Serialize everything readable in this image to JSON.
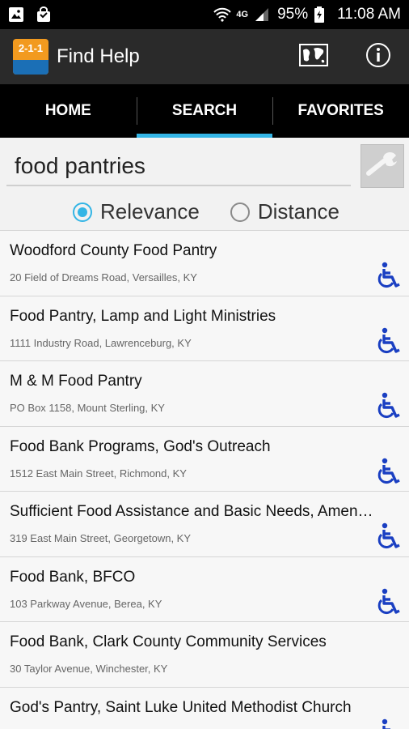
{
  "status_bar": {
    "signal_text": "4G",
    "battery": "95%",
    "time": "11:08 AM"
  },
  "app_bar": {
    "logo_text": "2-1-1",
    "title": "Find Help",
    "map_icon": "map-icon",
    "info_icon": "info-icon"
  },
  "tabs": [
    {
      "label": "HOME",
      "active": false
    },
    {
      "label": "SEARCH",
      "active": true
    },
    {
      "label": "FAVORITES",
      "active": false
    }
  ],
  "search": {
    "query": "food pantries",
    "settings_icon": "wrench-icon"
  },
  "sort": {
    "options": [
      {
        "label": "Relevance",
        "checked": true
      },
      {
        "label": "Distance",
        "checked": false
      }
    ]
  },
  "colors": {
    "accent": "#33b5e5",
    "access_icon": "#1a3fc2",
    "logo_orange": "#f29a1f",
    "logo_blue": "#1b6fb6"
  },
  "results": [
    {
      "name": "Woodford County Food Pantry",
      "address": "20 Field of Dreams Road, Versailles, KY"
    },
    {
      "name": "Food Pantry, Lamp and Light Ministries",
      "address": "1111 Industry Road, Lawrenceburg, KY"
    },
    {
      "name": "M & M Food Pantry",
      "address": "PO Box 1158, Mount Sterling, KY"
    },
    {
      "name": "Food Bank Programs, God's Outreach",
      "address": "1512 East Main Street, Richmond, KY"
    },
    {
      "name": "Sufficient Food Assistance and Basic Needs, Amen…",
      "address": "319 East Main Street, Georgetown, KY"
    },
    {
      "name": "Food Bank, BFCO",
      "address": "103 Parkway Avenue, Berea, KY"
    },
    {
      "name": "Food Bank, Clark County Community Services",
      "address": "30 Taylor Avenue, Winchester, KY"
    },
    {
      "name": "God's Pantry, Saint Luke United Methodist Church",
      "address": ""
    }
  ]
}
